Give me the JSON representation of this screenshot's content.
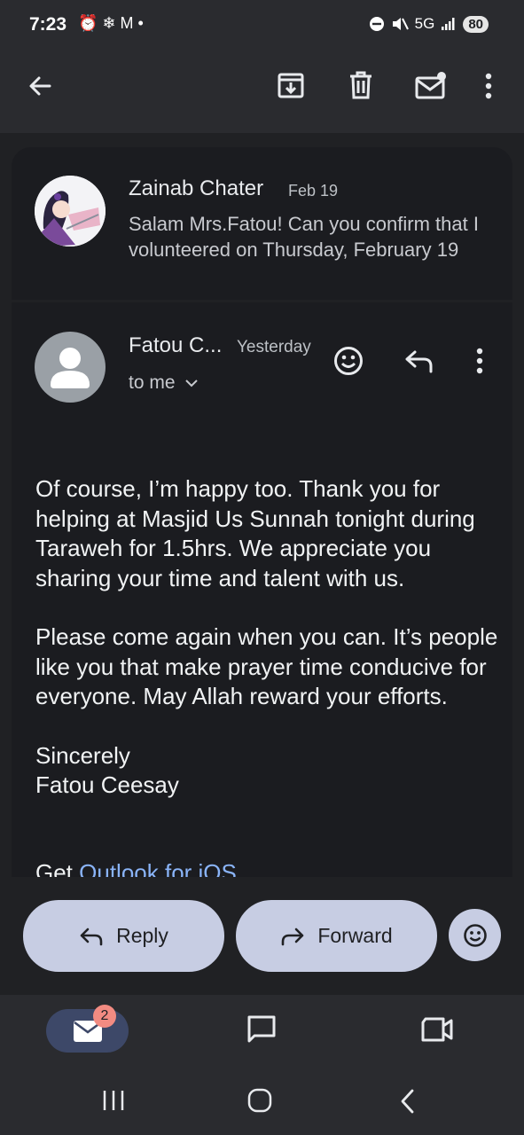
{
  "status_bar": {
    "time": "7:23",
    "left_icons": "⏰ ❄ M •",
    "network": "5G",
    "battery": "80"
  },
  "app_bar": {
    "icons": [
      "back-arrow-icon",
      "archive-icon",
      "delete-icon",
      "mark-unread-icon",
      "more-vert-icon"
    ]
  },
  "thread": {
    "message1": {
      "sender": "Zainab Chater",
      "date": "Feb 19",
      "snippet": "Salam Mrs.Fatou! Can you confirm that I volunteered on Thursday, February 19"
    },
    "message2": {
      "sender": "Fatou C...",
      "date": "Yesterday",
      "recipient": "to me",
      "paragraphs": [
        "Of course, I’m happy too. Thank you for helping at Masjid Us Sunnah tonight during Taraweh for 1.5hrs. We appreciate you sharing your time and talent with us.",
        "Please come again when you can. It’s people like you that make prayer time conducive for everyone. May Allah reward your efforts."
      ],
      "signoff": "Sincerely",
      "signature": "Fatou Ceesay",
      "footer_prefix": "Get ",
      "footer_link": "Outlook for iOS"
    }
  },
  "actions": {
    "reply_label": "Reply",
    "forward_label": "Forward"
  },
  "bottom_nav": {
    "mail_badge": "2"
  },
  "colors": {
    "background": "#202124",
    "card": "#1b1c20",
    "pill": "#c7cde3",
    "link": "#8ab4f8",
    "badge": "#f28b82"
  }
}
